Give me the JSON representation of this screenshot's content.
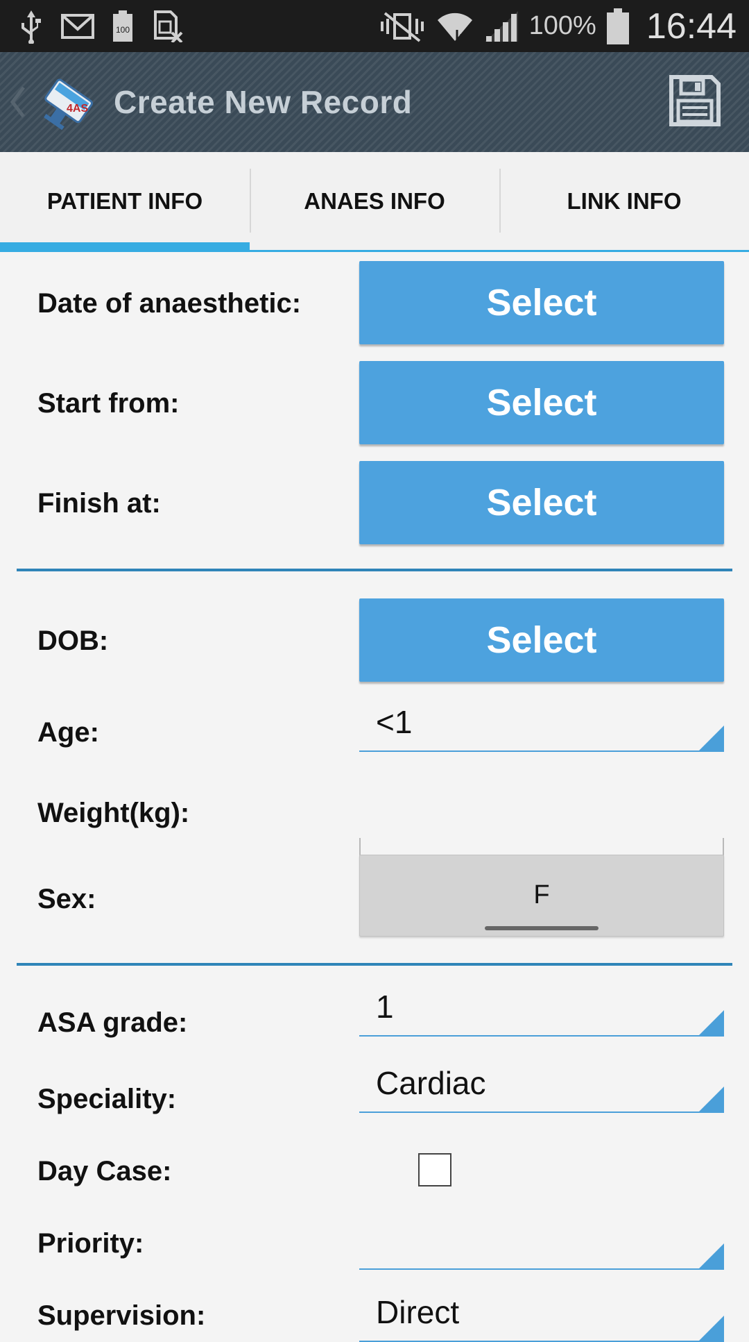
{
  "status_bar": {
    "battery_percent": "100%",
    "time": "16:44",
    "icons": [
      "usb-icon",
      "gmail-icon",
      "battery-100-icon",
      "sim-blocked-icon",
      "vibrate-mute-icon",
      "wifi-icon",
      "signal-icon",
      "battery-icon"
    ]
  },
  "action_bar": {
    "title": "Create New Record",
    "logo_text": "4AS"
  },
  "tabs": [
    {
      "label": "PATIENT INFO",
      "active": true
    },
    {
      "label": "ANAES INFO",
      "active": false
    },
    {
      "label": "LINK INFO",
      "active": false
    }
  ],
  "form": {
    "date_of_anaesthetic": {
      "label": "Date of anaesthetic:",
      "button": "Select"
    },
    "start_from": {
      "label": "Start from:",
      "button": "Select"
    },
    "finish_at": {
      "label": "Finish at:",
      "button": "Select"
    },
    "dob": {
      "label": "DOB:",
      "button": "Select"
    },
    "age": {
      "label": "Age:",
      "value": "<1"
    },
    "weight": {
      "label": "Weight(kg):",
      "value": ""
    },
    "sex": {
      "label": "Sex:",
      "value": "F"
    },
    "asa_grade": {
      "label": "ASA grade:",
      "value": "1"
    },
    "speciality": {
      "label": "Speciality:",
      "value": "Cardiac"
    },
    "day_case": {
      "label": "Day Case:",
      "checked": false
    },
    "priority": {
      "label": "Priority:",
      "value": ""
    },
    "supervision": {
      "label": "Supervision:",
      "value": "Direct"
    }
  },
  "colors": {
    "accent": "#36ace2",
    "button": "#4da2de",
    "divider": "#2f84b8",
    "action_bar": "#3a4a57"
  }
}
